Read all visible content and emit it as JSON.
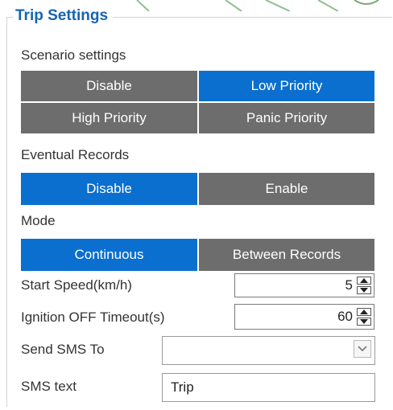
{
  "section": {
    "title": "Trip Settings"
  },
  "scenario": {
    "label": "Scenario settings",
    "options": [
      "Disable",
      "Low Priority",
      "High Priority",
      "Panic Priority"
    ],
    "selected": "Low Priority"
  },
  "eventual_records": {
    "label": "Eventual Records",
    "options": [
      "Disable",
      "Enable"
    ],
    "selected": "Disable"
  },
  "mode": {
    "label": "Mode",
    "options": [
      "Continuous",
      "Between Records"
    ],
    "selected": "Continuous"
  },
  "start_speed": {
    "label": "Start Speed(km/h)",
    "value": "5"
  },
  "ignition_off_timeout": {
    "label": "Ignition OFF Timeout(s)",
    "value": "60"
  },
  "send_sms_to": {
    "label": "Send SMS To",
    "value": ""
  },
  "sms_text": {
    "label": "SMS text",
    "value": "Trip"
  },
  "colors": {
    "title": "#1565b2",
    "segment_selected": "#0a6fce",
    "segment_unselected": "#6d6d6d"
  },
  "icons": {
    "spinner": "up-down-arrows-icon",
    "dropdown": "chevron-down-icon"
  }
}
